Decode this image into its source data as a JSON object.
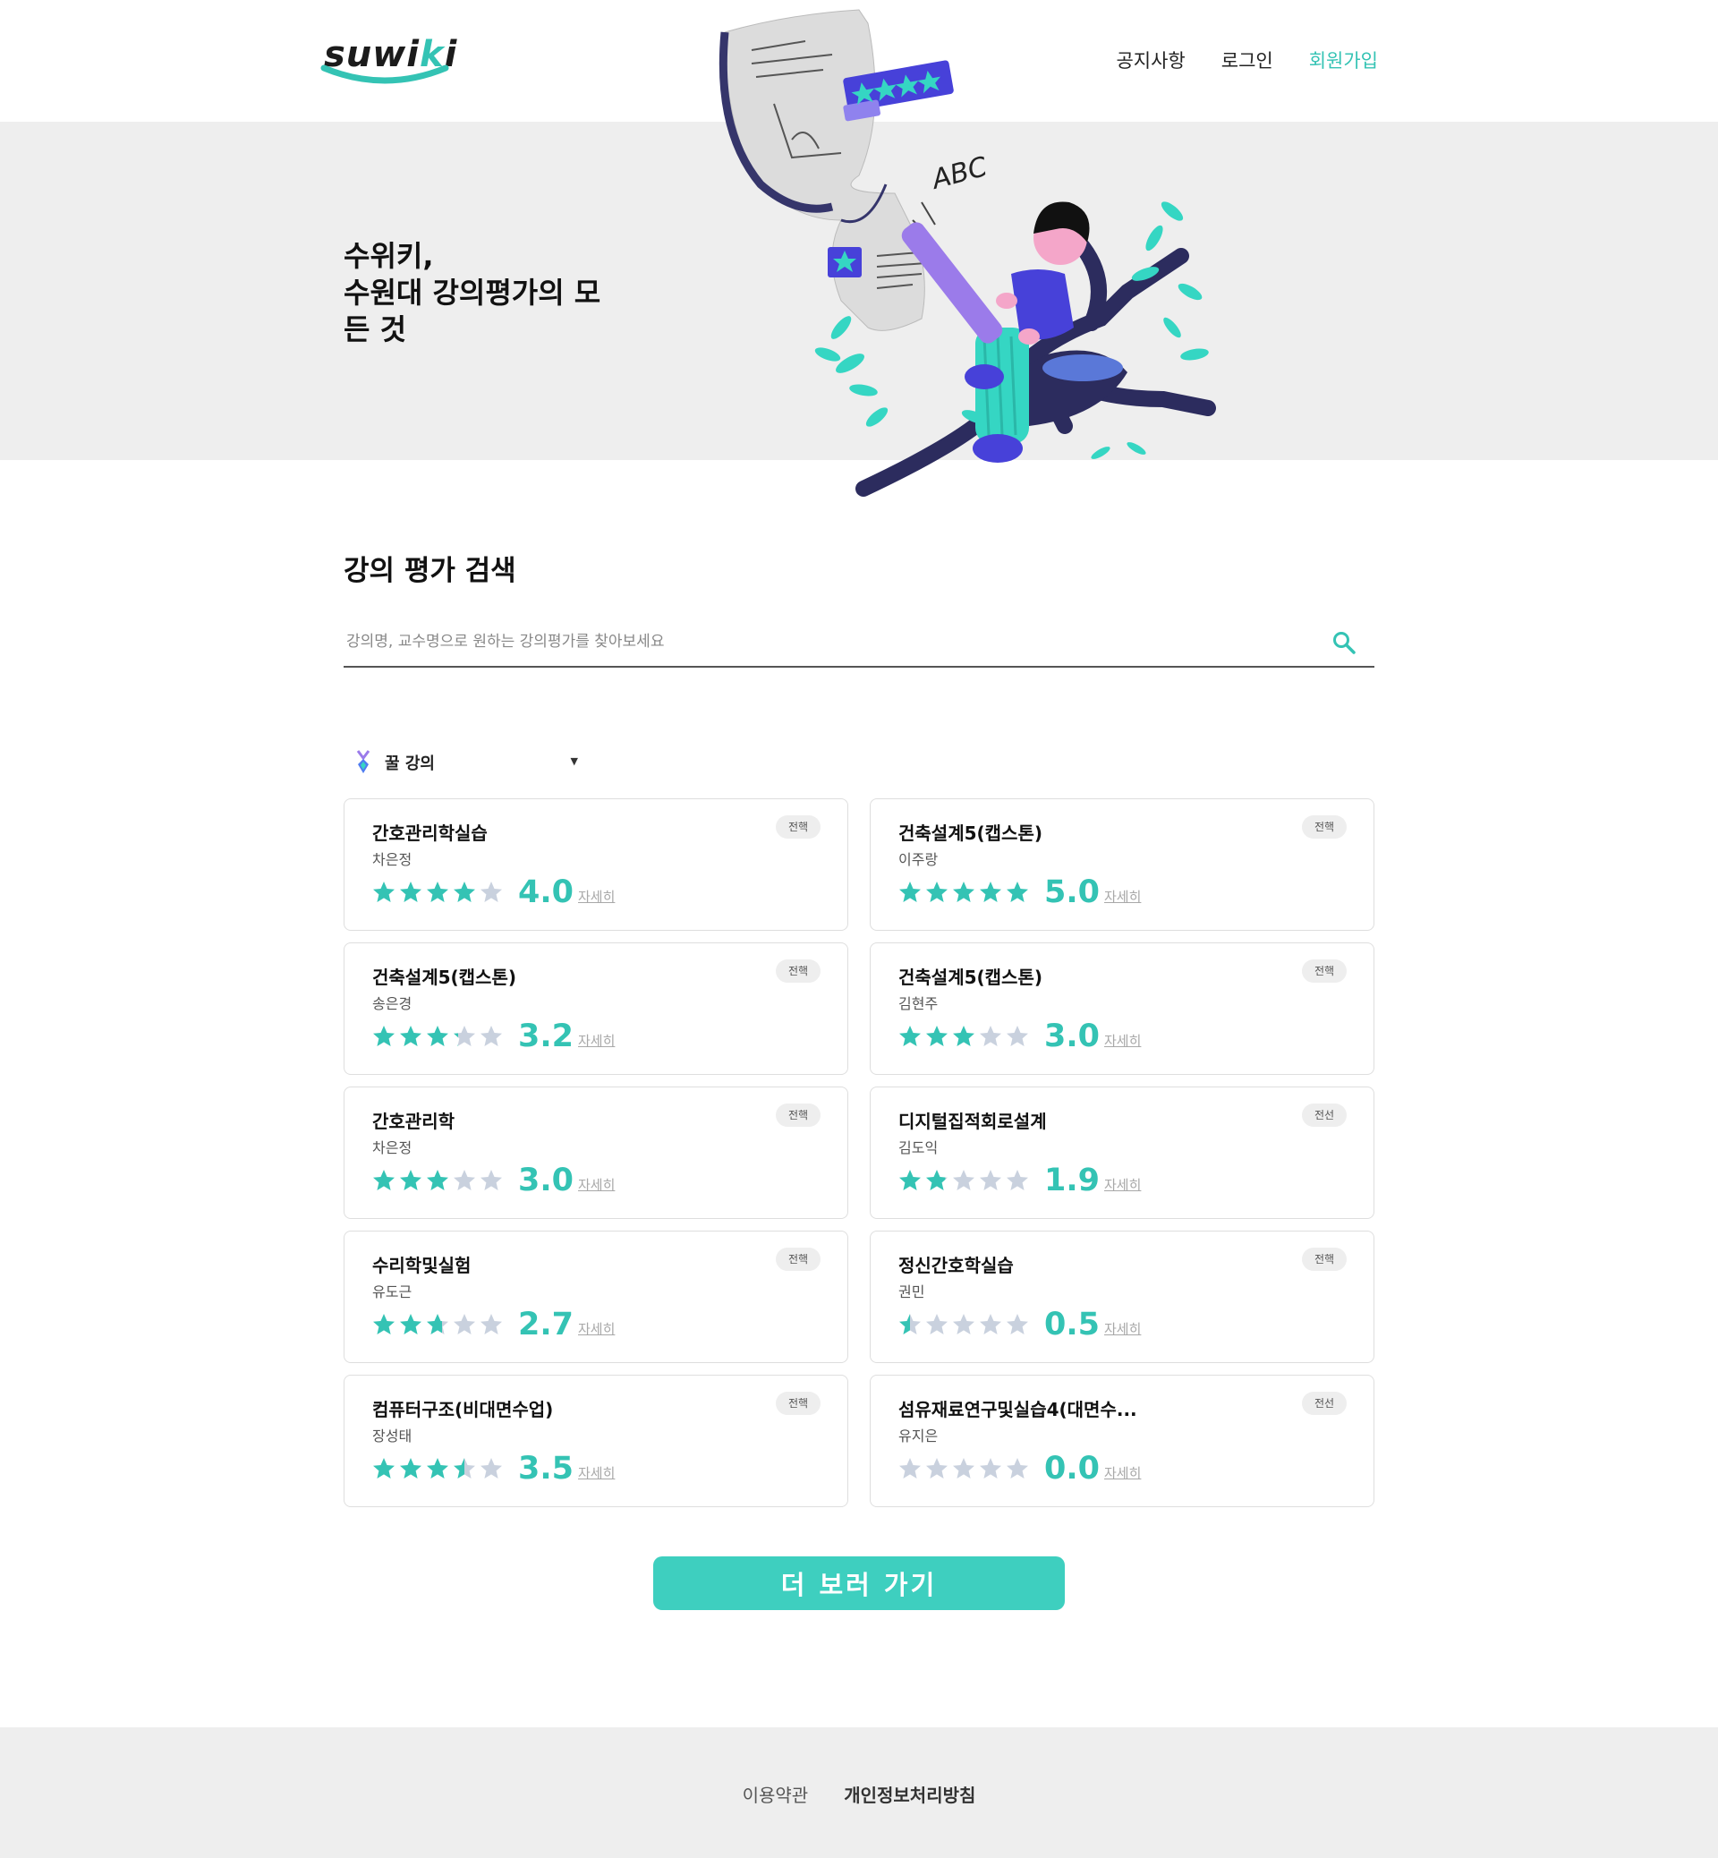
{
  "header": {
    "logo": {
      "prefix": "suwi",
      "accent": "k",
      "suffix": "i"
    },
    "nav": [
      {
        "label": "공지사항"
      },
      {
        "label": "로그인"
      },
      {
        "label": "회원가입"
      }
    ]
  },
  "hero": {
    "title_line1": "수위키,",
    "title_line2": "수원대 강의평가의 모",
    "title_line3": "든 것",
    "illustration": "student-writing-on-tree"
  },
  "search": {
    "title": "강의 평가 검색",
    "placeholder": "강의명, 교수명으로 원하는 강의평가를 찾아보세요",
    "value": "",
    "icon": "search-icon"
  },
  "category": {
    "icon": "medal-icon",
    "selected": "꿀 강의"
  },
  "lectures": [
    {
      "name": "간호관리학실습",
      "professor": "차은정",
      "major_type": "전핵",
      "rating": 4.0,
      "score_text": "4.0",
      "more": "자세히"
    },
    {
      "name": "건축설계5(캡스톤)",
      "professor": "이주랑",
      "major_type": "전핵",
      "rating": 5.0,
      "score_text": "5.0",
      "more": "자세히"
    },
    {
      "name": "건축설계5(캡스톤)",
      "professor": "송은경",
      "major_type": "전핵",
      "rating": 3.2,
      "score_text": "3.2",
      "more": "자세히"
    },
    {
      "name": "건축설계5(캡스톤)",
      "professor": "김현주",
      "major_type": "전핵",
      "rating": 3.0,
      "score_text": "3.0",
      "more": "자세히"
    },
    {
      "name": "간호관리학",
      "professor": "차은정",
      "major_type": "전핵",
      "rating": 3.0,
      "score_text": "3.0",
      "more": "자세히"
    },
    {
      "name": "디지털집적회로설계",
      "professor": "김도익",
      "major_type": "전선",
      "rating": 1.9,
      "score_text": "1.9",
      "more": "자세히"
    },
    {
      "name": "수리학및실험",
      "professor": "유도근",
      "major_type": "전핵",
      "rating": 2.7,
      "score_text": "2.7",
      "more": "자세히"
    },
    {
      "name": "정신간호학실습",
      "professor": "권민",
      "major_type": "전핵",
      "rating": 0.5,
      "score_text": "0.5",
      "more": "자세히"
    },
    {
      "name": "컴퓨터구조(비대면수업)",
      "professor": "장성태",
      "major_type": "전핵",
      "rating": 3.5,
      "score_text": "3.5",
      "more": "자세히"
    },
    {
      "name": "섬유재료연구및실습4(대면수...",
      "professor": "유지은",
      "major_type": "전선",
      "rating": 0.0,
      "score_text": "0.0",
      "more": "자세히"
    }
  ],
  "more_button": "더 보러 가기",
  "footer": {
    "terms": "이용약관",
    "privacy": "개인정보처리방침"
  },
  "colors": {
    "accent": "#34c3b4",
    "star_filled": "#34c3b4",
    "star_empty": "#c9d1de",
    "hero_bg": "#eeeeee"
  }
}
